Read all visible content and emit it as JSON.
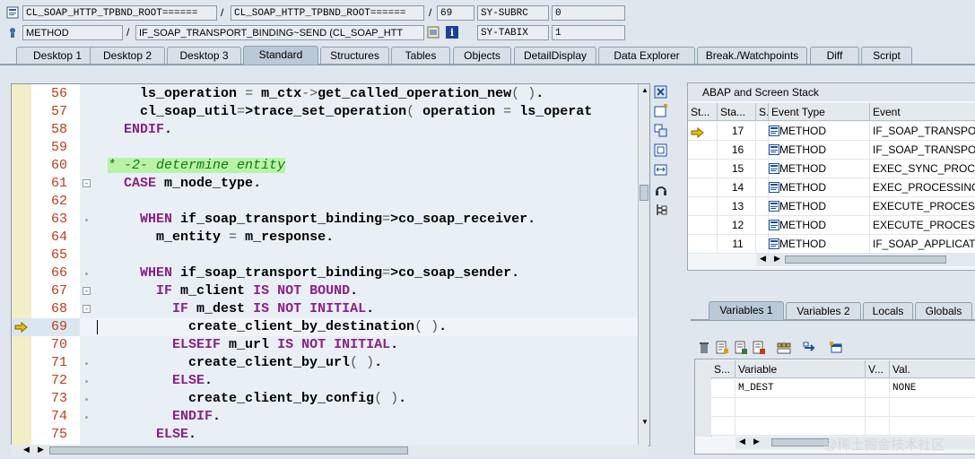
{
  "header": {
    "row1": {
      "field1": "CL_SOAP_HTTP_TPBND_ROOT======",
      "sep1": "/",
      "field2": "CL_SOAP_HTTP_TPBND_ROOT======",
      "sep2": "/",
      "line": "69",
      "sysvar": "SY-SUBRC",
      "sysval": "0"
    },
    "row2": {
      "type": "METHOD",
      "sep": "/",
      "name": "IF_SOAP_TRANSPORT_BINDING~SEND (CL_SOAP_HTT",
      "sysvar": "SY-TABIX",
      "sysval": "1"
    }
  },
  "tabs": [
    "Desktop 1",
    "Desktop 2",
    "Desktop 3",
    "Standard",
    "Structures",
    "Tables",
    "Objects",
    "DetailDisplay",
    "Data Explorer",
    "Break./Watchpoints",
    "Diff",
    "Script"
  ],
  "code": [
    {
      "num": "56",
      "text": "    ls_operation = m_ctx->get_called_operation_new( )."
    },
    {
      "num": "57",
      "text": "    cl_soap_util=>trace_set_operation( operation = ls_operat"
    },
    {
      "num": "58",
      "text": "  ENDIF."
    },
    {
      "num": "59",
      "text": ""
    },
    {
      "num": "60",
      "text": "* -2- determine entity"
    },
    {
      "num": "61",
      "text": "  CASE m_node_type."
    },
    {
      "num": "62",
      "text": ""
    },
    {
      "num": "63",
      "text": "    WHEN if_soap_transport_binding=>co_soap_receiver."
    },
    {
      "num": "64",
      "text": "      m_entity = m_response."
    },
    {
      "num": "65",
      "text": ""
    },
    {
      "num": "66",
      "text": "    WHEN if_soap_transport_binding=>co_soap_sender."
    },
    {
      "num": "67",
      "text": "      IF m_client IS NOT BOUND."
    },
    {
      "num": "68",
      "text": "        IF m_dest IS NOT INITIAL."
    },
    {
      "num": "69",
      "text": "          create_client_by_destination( )."
    },
    {
      "num": "70",
      "text": "        ELSEIF m_url IS NOT INITIAL."
    },
    {
      "num": "71",
      "text": "          create_client_by_url( )."
    },
    {
      "num": "72",
      "text": "        ELSE."
    },
    {
      "num": "73",
      "text": "          create_client_by_config( )."
    },
    {
      "num": "74",
      "text": "        ENDIF."
    },
    {
      "num": "75",
      "text": "      ELSE."
    }
  ],
  "stack": {
    "title": "ABAP and Screen Stack",
    "columns": [
      "St...",
      "Sta...",
      "S...",
      "Event Type",
      "Event"
    ],
    "rows": [
      {
        "level": "17",
        "type": "METHOD",
        "event": "IF_SOAP_TRANSPORT"
      },
      {
        "level": "16",
        "type": "METHOD",
        "event": "IF_SOAP_TRANSPORT"
      },
      {
        "level": "15",
        "type": "METHOD",
        "event": "EXEC_SYNC_PROCESS"
      },
      {
        "level": "14",
        "type": "METHOD",
        "event": "EXEC_PROCESSING"
      },
      {
        "level": "13",
        "type": "METHOD",
        "event": "EXECUTE_PROCESSIN"
      },
      {
        "level": "12",
        "type": "METHOD",
        "event": "EXECUTE_PROCESSIN"
      },
      {
        "level": "11",
        "type": "METHOD",
        "event": "IF_SOAP_APPLICATIO"
      }
    ]
  },
  "vartabs": [
    "Variables 1",
    "Variables 2",
    "Locals",
    "Globals"
  ],
  "vars": {
    "columns": [
      "S...",
      "Variable",
      "V...",
      "Val."
    ],
    "rows": [
      {
        "variable": "M_DEST",
        "value": "NONE"
      }
    ]
  },
  "watermark": "@稀土掘金技术社区"
}
